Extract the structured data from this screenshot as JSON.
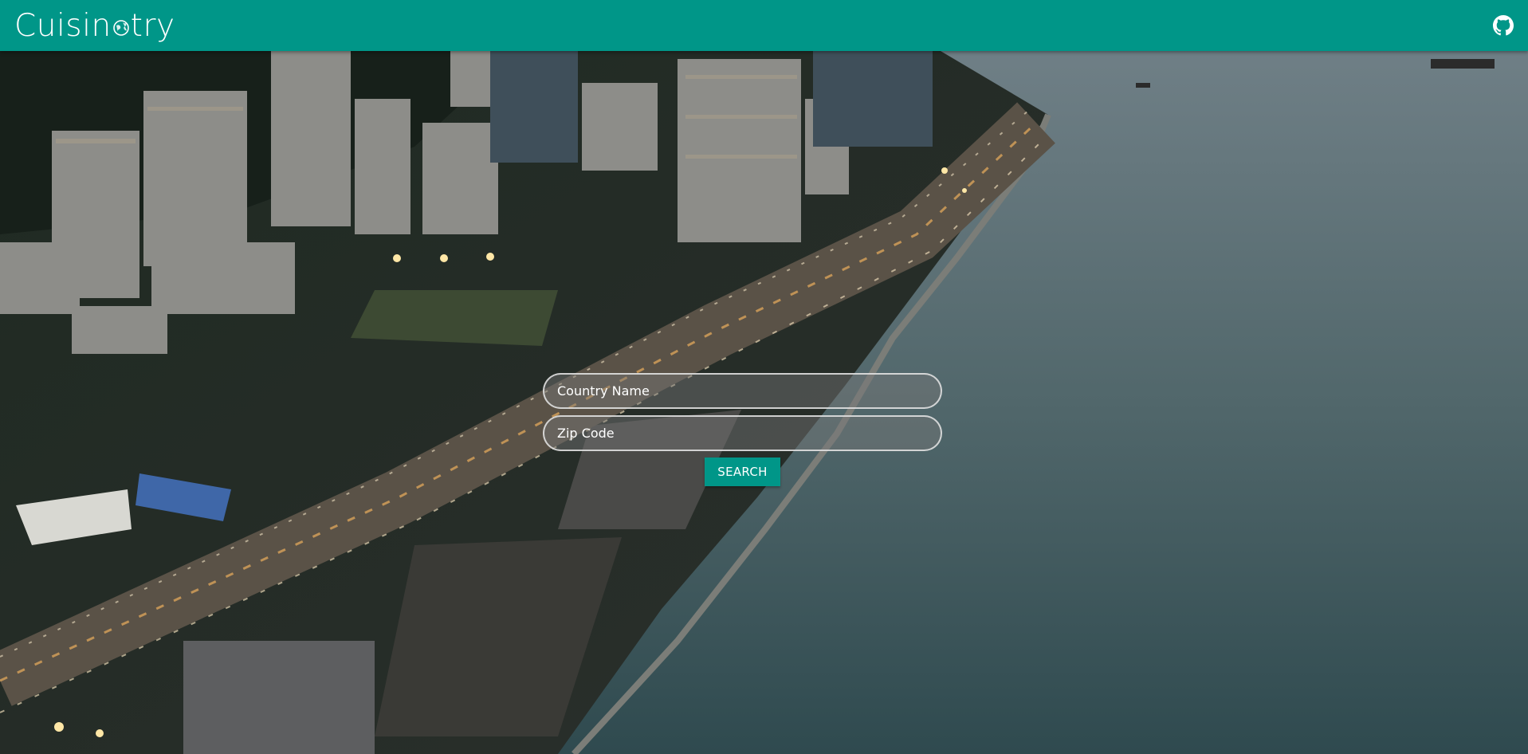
{
  "theme": {
    "primary": "#009688",
    "white": "#ffffff"
  },
  "navbar": {
    "brand_part1": "Cuisin",
    "brand_part2": "try",
    "brand_globe_icon": "globe-icon",
    "github_icon": "github-icon"
  },
  "search": {
    "country_placeholder": "Country Name",
    "zip_placeholder": "Zip Code",
    "button_label": "SEARCH"
  },
  "background": {
    "icon": "city-waterfront-video"
  }
}
